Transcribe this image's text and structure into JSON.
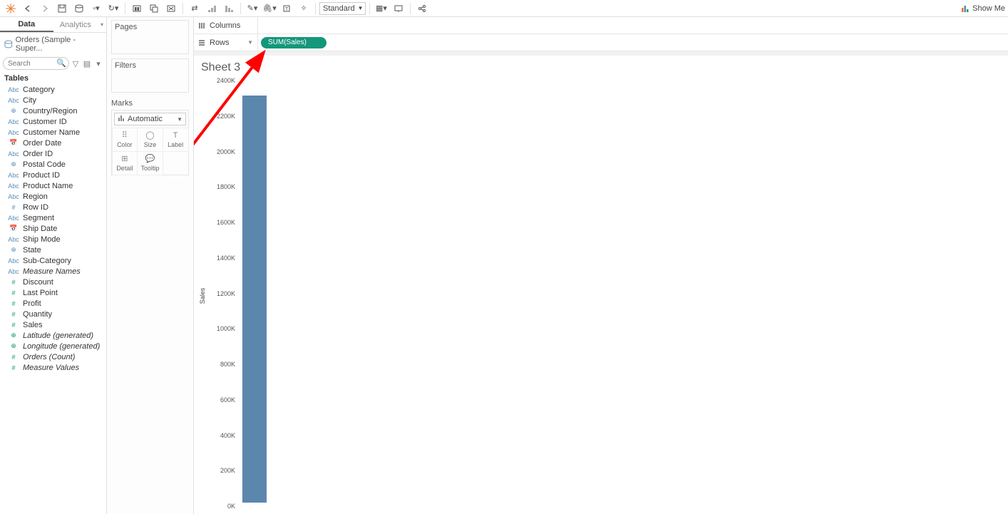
{
  "toolbar": {
    "standard_label": "Standard",
    "showme_label": "Show Me"
  },
  "left": {
    "tab_data": "Data",
    "tab_analytics": "Analytics",
    "datasource": "Orders (Sample - Super...",
    "search_placeholder": "Search",
    "tables_hdr": "Tables",
    "fields": [
      {
        "icon": "Abc",
        "kind": "dim",
        "label": "Category"
      },
      {
        "icon": "Abc",
        "kind": "dim",
        "label": "City"
      },
      {
        "icon": "⊕",
        "kind": "dim",
        "label": "Country/Region"
      },
      {
        "icon": "Abc",
        "kind": "dim",
        "label": "Customer ID"
      },
      {
        "icon": "Abc",
        "kind": "dim",
        "label": "Customer Name"
      },
      {
        "icon": "📅",
        "kind": "dim",
        "label": "Order Date"
      },
      {
        "icon": "Abc",
        "kind": "dim",
        "label": "Order ID"
      },
      {
        "icon": "⊕",
        "kind": "dim",
        "label": "Postal Code"
      },
      {
        "icon": "Abc",
        "kind": "dim",
        "label": "Product ID"
      },
      {
        "icon": "Abc",
        "kind": "dim",
        "label": "Product Name"
      },
      {
        "icon": "Abc",
        "kind": "dim",
        "label": "Region"
      },
      {
        "icon": "#",
        "kind": "dim",
        "label": "Row ID"
      },
      {
        "icon": "Abc",
        "kind": "dim",
        "label": "Segment"
      },
      {
        "icon": "📅",
        "kind": "dim",
        "label": "Ship Date"
      },
      {
        "icon": "Abc",
        "kind": "dim",
        "label": "Ship Mode"
      },
      {
        "icon": "⊕",
        "kind": "dim",
        "label": "State"
      },
      {
        "icon": "Abc",
        "kind": "dim",
        "label": "Sub-Category"
      },
      {
        "icon": "Abc",
        "kind": "dim",
        "label": "Measure Names",
        "italic": true
      },
      {
        "icon": "#",
        "kind": "meas",
        "label": "Discount"
      },
      {
        "icon": "#",
        "kind": "meas",
        "label": "Last Point"
      },
      {
        "icon": "#",
        "kind": "meas",
        "label": "Profit"
      },
      {
        "icon": "#",
        "kind": "meas",
        "label": "Quantity"
      },
      {
        "icon": "#",
        "kind": "meas",
        "label": "Sales"
      },
      {
        "icon": "⊕",
        "kind": "meas",
        "label": "Latitude (generated)",
        "italic": true
      },
      {
        "icon": "⊕",
        "kind": "meas",
        "label": "Longitude (generated)",
        "italic": true
      },
      {
        "icon": "#",
        "kind": "meas",
        "label": "Orders (Count)",
        "italic": true
      },
      {
        "icon": "#",
        "kind": "meas",
        "label": "Measure Values",
        "italic": true
      }
    ]
  },
  "cards": {
    "pages": "Pages",
    "filters": "Filters",
    "marks": "Marks",
    "mark_type": "Automatic",
    "cells": [
      "Color",
      "Size",
      "Label",
      "Detail",
      "Tooltip"
    ],
    "cell_icons": [
      "⠿",
      "◯",
      "T",
      "⊞",
      "💬"
    ]
  },
  "shelves": {
    "columns": "Columns",
    "rows": "Rows",
    "pill_rows": "SUM(Sales)"
  },
  "view": {
    "title": "Sheet 3",
    "yaxis_title": "Sales"
  },
  "chart_data": {
    "type": "bar",
    "categories": [
      ""
    ],
    "values": [
      2297201
    ],
    "ylabel": "Sales",
    "xlabel": "",
    "title": "Sheet 3",
    "ylim": [
      0,
      2400000
    ],
    "yticks": [
      0,
      200000,
      400000,
      600000,
      800000,
      1000000,
      1200000,
      1400000,
      1600000,
      1800000,
      2000000,
      2200000,
      2400000
    ],
    "ytick_labels": [
      "0K",
      "200K",
      "400K",
      "600K",
      "800K",
      "1000K",
      "1200K",
      "1400K",
      "1600K",
      "1800K",
      "2000K",
      "2200K",
      "2400K"
    ]
  }
}
